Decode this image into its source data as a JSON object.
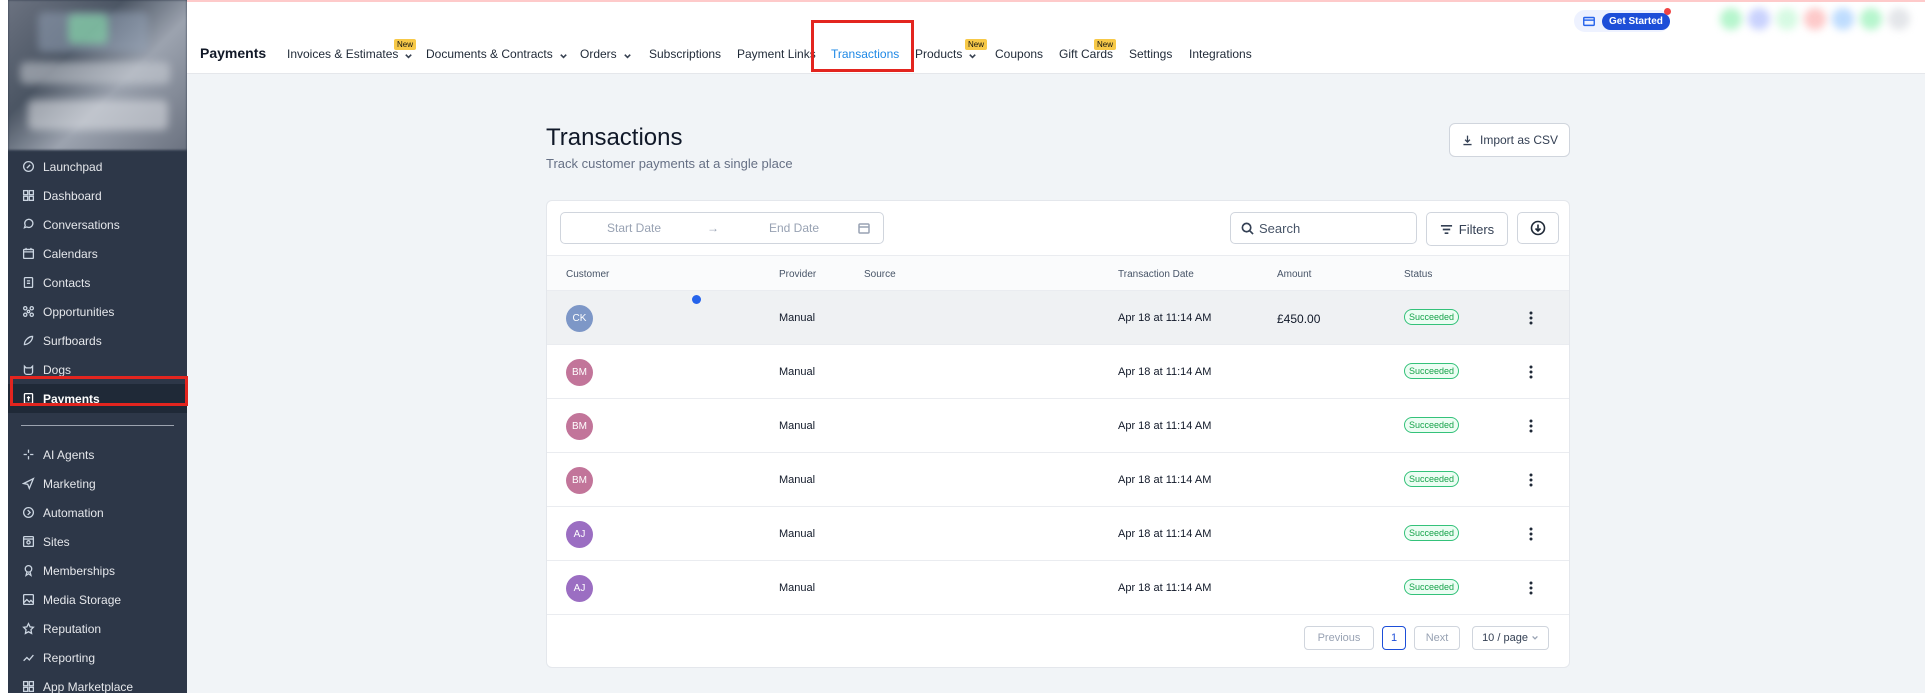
{
  "topbar": {
    "brand": "Payments",
    "nav": [
      {
        "label": "Invoices & Estimates",
        "dropdown": true,
        "badge": "New"
      },
      {
        "label": "Documents & Contracts",
        "dropdown": true
      },
      {
        "label": "Orders",
        "dropdown": true
      },
      {
        "label": "Subscriptions"
      },
      {
        "label": "Payment Links"
      },
      {
        "label": "Transactions",
        "active": true
      },
      {
        "label": "Products",
        "dropdown": true,
        "badge": "New"
      },
      {
        "label": "Coupons"
      },
      {
        "label": "Gift Cards",
        "badge": "New"
      },
      {
        "label": "Settings"
      },
      {
        "label": "Integrations"
      }
    ],
    "get_started": "Get Started"
  },
  "sidebar": {
    "items": [
      {
        "label": "Launchpad",
        "icon": "rocket-icon"
      },
      {
        "label": "Dashboard",
        "icon": "grid-icon"
      },
      {
        "label": "Conversations",
        "icon": "chat-icon"
      },
      {
        "label": "Calendars",
        "icon": "calendar-icon"
      },
      {
        "label": "Contacts",
        "icon": "contacts-icon"
      },
      {
        "label": "Opportunities",
        "icon": "opportunities-icon"
      },
      {
        "label": "Surfboards",
        "icon": "surfboard-icon"
      },
      {
        "label": "Dogs",
        "icon": "dog-icon"
      },
      {
        "label": "Payments",
        "icon": "payments-icon",
        "active": true
      }
    ],
    "items2": [
      {
        "label": "AI Agents",
        "icon": "sparkle-icon"
      },
      {
        "label": "Marketing",
        "icon": "send-icon"
      },
      {
        "label": "Automation",
        "icon": "automation-icon"
      },
      {
        "label": "Sites",
        "icon": "sites-icon"
      },
      {
        "label": "Memberships",
        "icon": "membership-icon"
      },
      {
        "label": "Media Storage",
        "icon": "image-icon"
      },
      {
        "label": "Reputation",
        "icon": "star-icon"
      },
      {
        "label": "Reporting",
        "icon": "chart-icon"
      },
      {
        "label": "App Marketplace",
        "icon": "apps-icon"
      }
    ]
  },
  "main": {
    "title": "Transactions",
    "subtitle": "Track customer payments at a single place",
    "import_label": "Import as CSV",
    "date_start_placeholder": "Start Date",
    "date_end_placeholder": "End Date",
    "date_arrow": "→",
    "search_placeholder": "Search",
    "filters_label": "Filters",
    "columns": {
      "customer": "Customer",
      "provider": "Provider",
      "source": "Source",
      "date": "Transaction Date",
      "amount": "Amount",
      "status": "Status"
    },
    "rows": [
      {
        "initials": "CK",
        "color": "#7d97c7",
        "provider": "Manual",
        "source": "",
        "date": "Apr 18 at 11:14 AM",
        "amount": "£450.00",
        "status": "Succeeded"
      },
      {
        "initials": "BM",
        "color": "#c2759a",
        "provider": "Manual",
        "source": "",
        "date": "Apr 18 at 11:14 AM",
        "amount": "",
        "status": "Succeeded"
      },
      {
        "initials": "BM",
        "color": "#c2759a",
        "provider": "Manual",
        "source": "",
        "date": "Apr 18 at 11:14 AM",
        "amount": "",
        "status": "Succeeded"
      },
      {
        "initials": "BM",
        "color": "#c2759a",
        "provider": "Manual",
        "source": "",
        "date": "Apr 18 at 11:14 AM",
        "amount": "",
        "status": "Succeeded"
      },
      {
        "initials": "AJ",
        "color": "#9b6ec2",
        "provider": "Manual",
        "source": "",
        "date": "Apr 18 at 11:14 AM",
        "amount": "",
        "status": "Succeeded"
      },
      {
        "initials": "AJ",
        "color": "#9b6ec2",
        "provider": "Manual",
        "source": "",
        "date": "Apr 18 at 11:14 AM",
        "amount": "",
        "status": "Succeeded"
      }
    ],
    "pager": {
      "previous": "Previous",
      "current": "1",
      "next": "Next",
      "page_size": "10 / page"
    }
  },
  "colors": {
    "accent": "#1e88e5",
    "highlight": "#e3251f",
    "sidebar_bg": "#2d3748",
    "success": "#16a34a"
  }
}
